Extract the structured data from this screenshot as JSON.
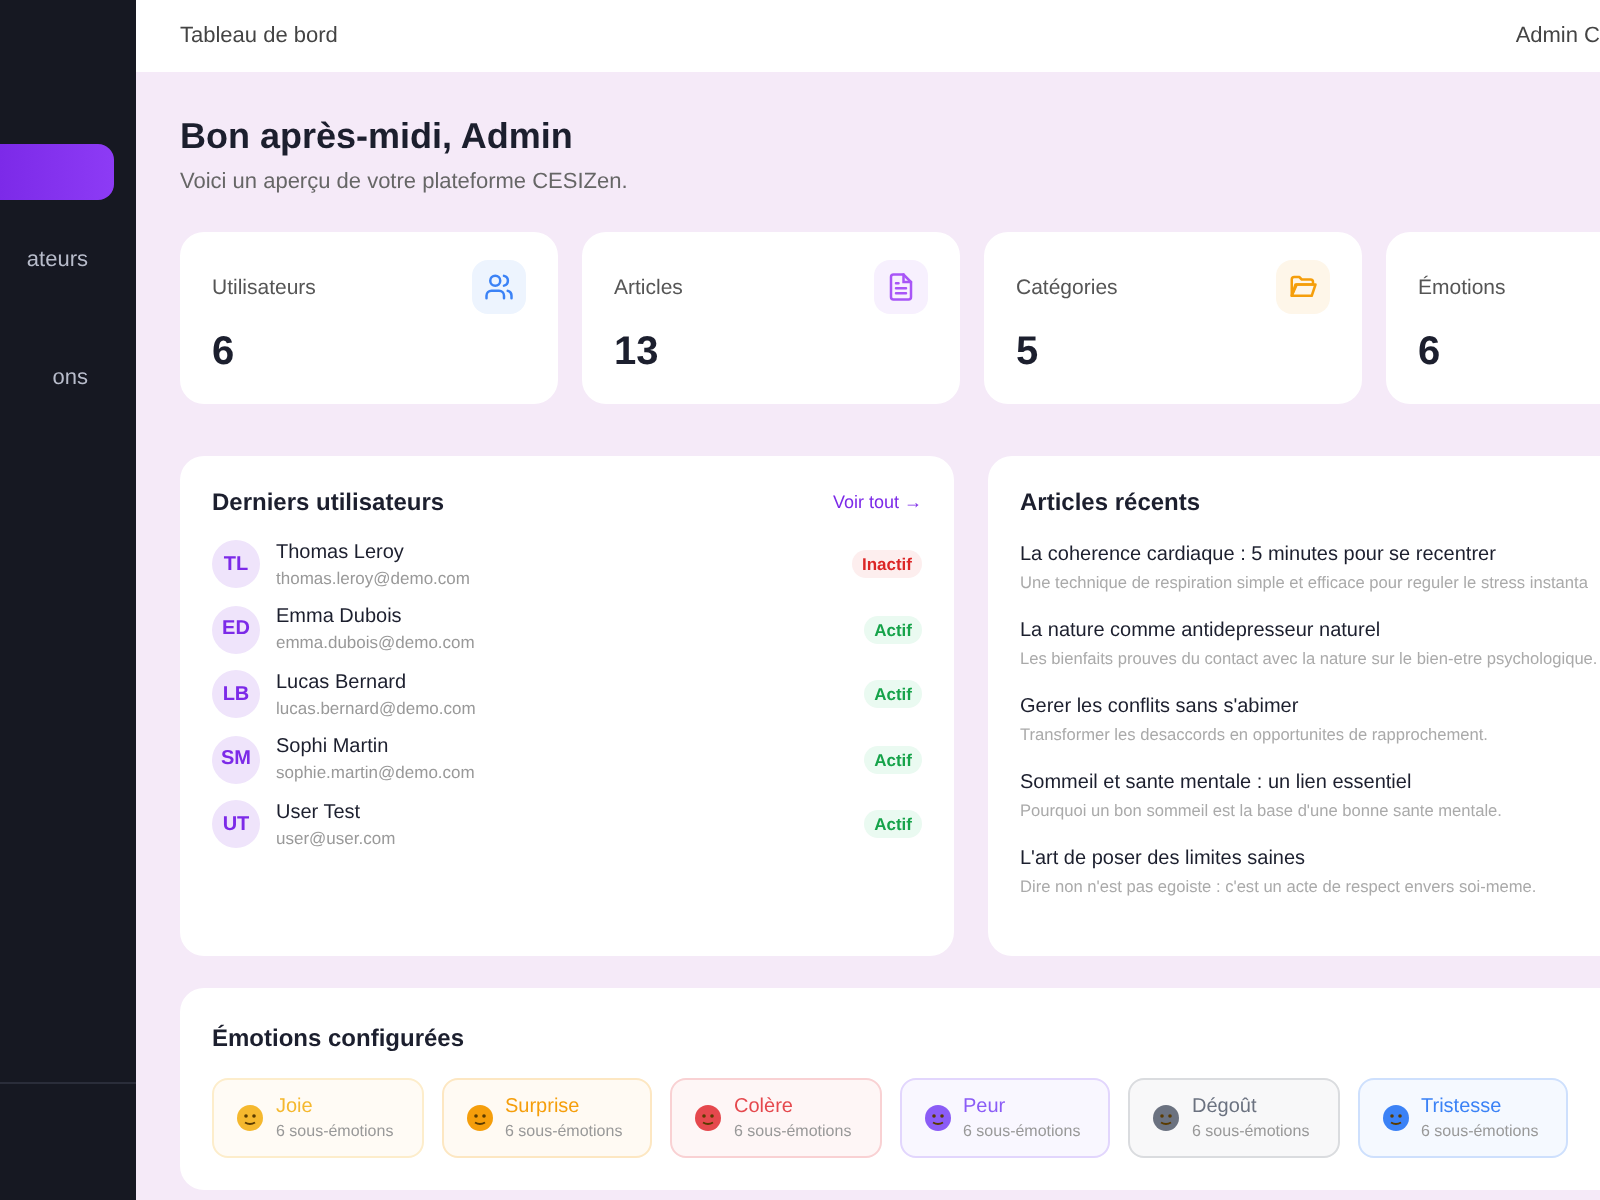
{
  "sidebar": {
    "items": [
      {
        "selected": true
      },
      {
        "label": "ateurs",
        "selected": false
      },
      {
        "label": "ons",
        "selected": false
      }
    ]
  },
  "header": {
    "title": "Tableau de bord",
    "user": "Admin C"
  },
  "greeting": {
    "title": "Bon après-midi, Admin",
    "subtitle": "Voici un aperçu de votre plateforme CESIZen."
  },
  "stats": [
    {
      "label": "Utilisateurs",
      "value": "6",
      "kind": "users",
      "color": "#3b82f6"
    },
    {
      "label": "Articles",
      "value": "13",
      "kind": "article",
      "color": "#a855f7"
    },
    {
      "label": "Catégories",
      "value": "5",
      "kind": "folder",
      "color": "#f59e0b"
    },
    {
      "label": "Émotions",
      "value": "6",
      "kind": "none"
    }
  ],
  "recent_users": {
    "title": "Derniers utilisateurs",
    "link": "Voir tout →",
    "rows": [
      {
        "initials": "TL",
        "name": "Thomas Leroy",
        "email": "thomas.leroy@demo.com",
        "status": "Inactif",
        "active": false
      },
      {
        "initials": "ED",
        "name": "Emma Dubois",
        "email": "emma.dubois@demo.com",
        "status": "Actif",
        "active": true
      },
      {
        "initials": "LB",
        "name": "Lucas Bernard",
        "email": "lucas.bernard@demo.com",
        "status": "Actif",
        "active": true
      },
      {
        "initials": "SM",
        "name": "Sophi Martin",
        "email": "sophie.martin@demo.com",
        "status": "Actif",
        "active": true
      },
      {
        "initials": "UT",
        "name": "User Test",
        "email": "user@user.com",
        "status": "Actif",
        "active": true
      }
    ]
  },
  "recent_articles": {
    "title": "Articles récents",
    "items": [
      {
        "title": "La coherence cardiaque : 5 minutes pour se recentrer",
        "summary": "Une technique de respiration simple et efficace pour reguler le stress instanta"
      },
      {
        "title": "La nature comme antidepresseur naturel",
        "summary": "Les bienfaits prouves du contact avec la nature sur le bien-etre psychologique."
      },
      {
        "title": "Gerer les conflits sans s'abimer",
        "summary": "Transformer les desaccords en opportunites de rapprochement."
      },
      {
        "title": "Sommeil et sante mentale : un lien essentiel",
        "summary": "Pourquoi un bon sommeil est la base d'une bonne sante mentale."
      },
      {
        "title": "L'art de poser des limites saines",
        "summary": "Dire non n'est pas egoiste : c'est un acte de respect envers soi-meme."
      }
    ]
  },
  "emotions": {
    "title": "Émotions configurées",
    "items": [
      {
        "name": "Joie",
        "count": "6 sous-émotions",
        "color": "#f5b82e"
      },
      {
        "name": "Surprise",
        "count": "6 sous-émotions",
        "color": "#f59e0b"
      },
      {
        "name": "Colère",
        "count": "6 sous-émotions",
        "color": "#e5484d"
      },
      {
        "name": "Peur",
        "count": "6 sous-émotions",
        "color": "#8b5cf6"
      },
      {
        "name": "Dégoût",
        "count": "6 sous-émotions",
        "color": "#6b7280"
      },
      {
        "name": "Tristesse",
        "count": "6 sous-émotions",
        "color": "#3b82f6"
      }
    ]
  }
}
